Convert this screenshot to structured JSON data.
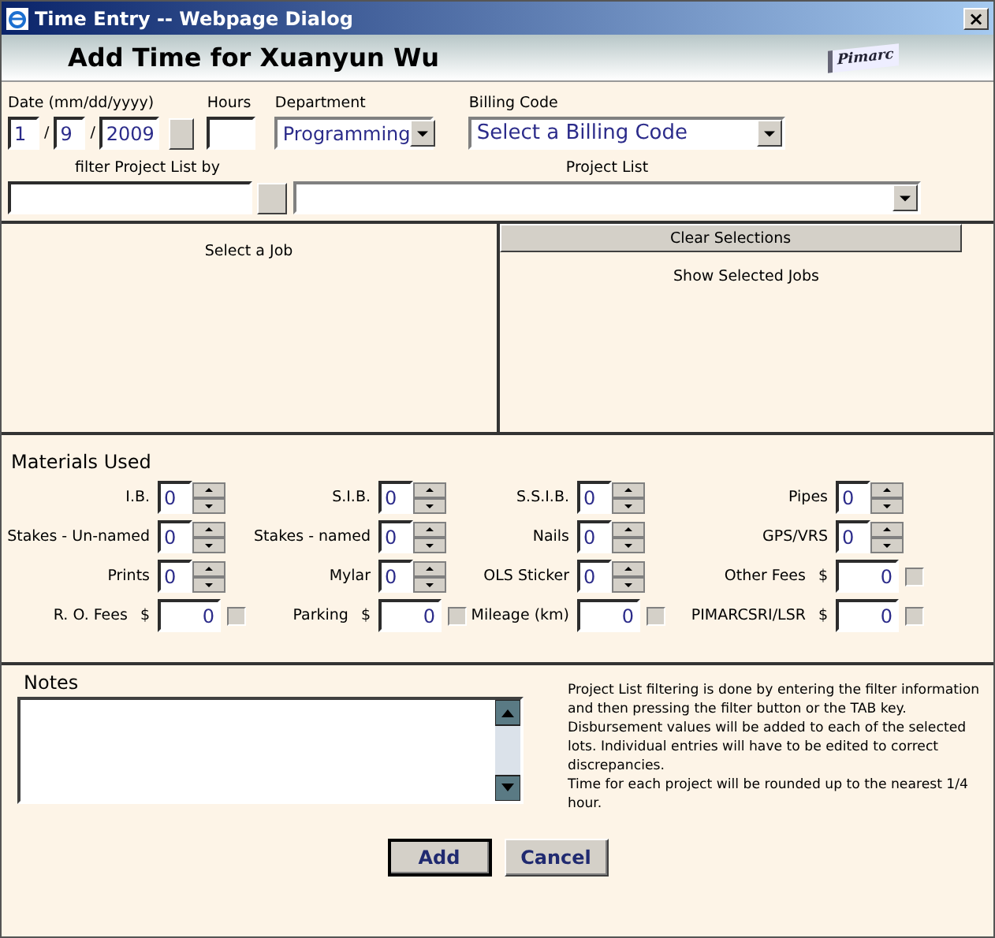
{
  "window": {
    "title": "Time Entry -- Webpage Dialog",
    "close": "×"
  },
  "header": {
    "title": "Add Time for Xuanyun Wu",
    "logo": "Pimarc"
  },
  "date": {
    "label": "Date (mm/dd/yyyy)",
    "month": "1",
    "day": "9",
    "year": "2009",
    "separator": "/"
  },
  "hours": {
    "label": "Hours"
  },
  "department": {
    "label": "Department",
    "value": "Programming"
  },
  "billing_code": {
    "label": "Billing Code",
    "value": "Select a Billing Code"
  },
  "filter": {
    "label": "filter Project List by"
  },
  "project_list": {
    "label": "Project List"
  },
  "jobs": {
    "left_label": "Select a Job",
    "clear_button": "Clear Selections",
    "right_label": "Show Selected Jobs"
  },
  "materials": {
    "title": "Materials Used",
    "rows": [
      [
        {
          "kind": "spinner",
          "label": "I.B.",
          "value": "0"
        },
        {
          "kind": "spinner",
          "label": "S.I.B.",
          "value": "0"
        },
        {
          "kind": "spinner",
          "label": "S.S.I.B.",
          "value": "0"
        },
        {
          "kind": "spinner",
          "label": "Pipes",
          "value": "0"
        }
      ],
      [
        {
          "kind": "spinner",
          "label": "Stakes - Un-named",
          "value": "0"
        },
        {
          "kind": "spinner",
          "label": "Stakes - named",
          "value": "0"
        },
        {
          "kind": "spinner",
          "label": "Nails",
          "value": "0"
        },
        {
          "kind": "spinner",
          "label": "GPS/VRS",
          "value": "0"
        }
      ],
      [
        {
          "kind": "spinner",
          "label": "Prints",
          "value": "0"
        },
        {
          "kind": "spinner",
          "label": "Mylar",
          "value": "0"
        },
        {
          "kind": "spinner",
          "label": "OLS Sticker",
          "value": "0"
        },
        {
          "kind": "amount",
          "label": "Other Fees",
          "currency": "$",
          "value": "0",
          "checked": false
        }
      ],
      [
        {
          "kind": "amount",
          "label": "R. O. Fees",
          "currency": "$",
          "value": "0",
          "checked": false
        },
        {
          "kind": "amount",
          "label": "Parking",
          "currency": "$",
          "value": "0",
          "checked": false
        },
        {
          "kind": "amount",
          "label": "Mileage (km)",
          "value": "0",
          "checked": false
        },
        {
          "kind": "amount",
          "label": "PIMARCSRI/LSR",
          "currency": "$",
          "value": "0",
          "checked": false
        }
      ]
    ]
  },
  "notes": {
    "label": "Notes"
  },
  "help_text": [
    "Project List filtering is done by entering the filter information and then pressing the filter button or the TAB key.",
    "Disbursement values will be added to each of the selected lots. Individual entries will have to be edited to correct discrepancies.",
    "Time for each project will be rounded up to the nearest 1/4 hour."
  ],
  "buttons": [
    {
      "label": "Add",
      "default": true
    },
    {
      "label": "Cancel",
      "default": false
    }
  ]
}
